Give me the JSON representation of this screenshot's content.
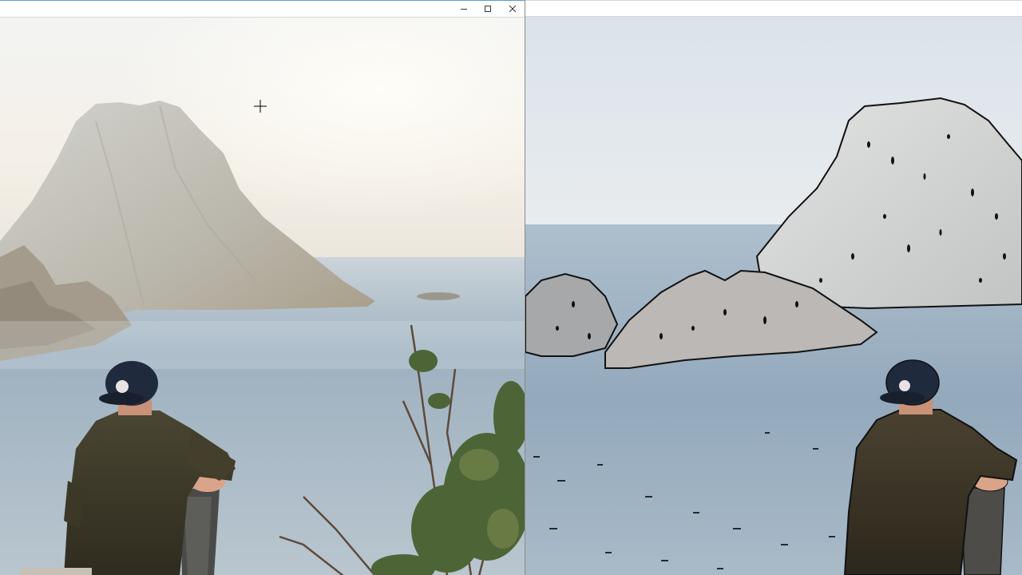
{
  "left_window": {
    "title": "",
    "controls": {
      "minimize_icon": "minimize-icon",
      "maximize_icon": "maximize-icon",
      "close_icon": "close-icon"
    },
    "image": {
      "description_icon": "photo-original",
      "sky_color": "#f1f3f2",
      "sea_color": "#a9bccb",
      "rock_color": "#c9c7c0"
    }
  },
  "right_window": {
    "title": "",
    "image": {
      "description_icon": "photo-cartoon-filtered",
      "sky_color": "#dfe6ec",
      "sea_color": "#9fb4c6",
      "rock_color": "#d3d4d4"
    }
  },
  "cursor": {
    "icon": "crosshair-cursor-icon"
  }
}
